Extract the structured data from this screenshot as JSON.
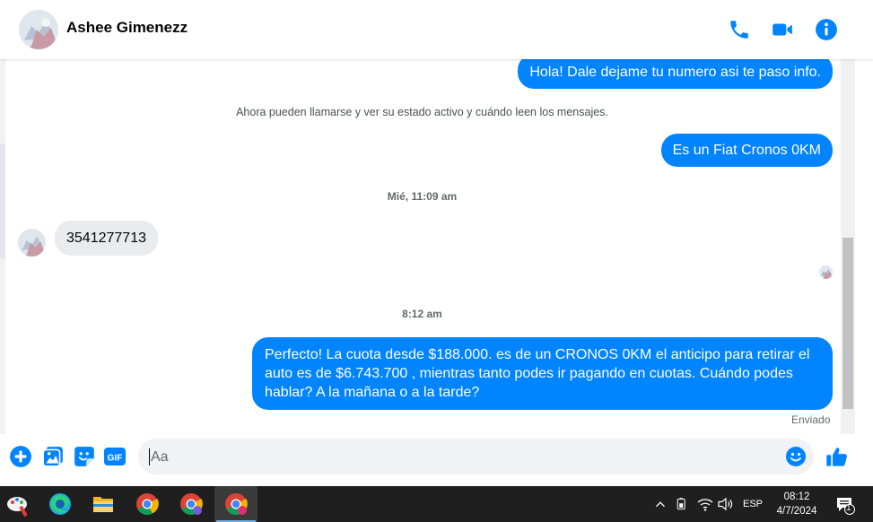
{
  "header": {
    "contact_name": "Ashee Gimenezz",
    "icons": [
      "phone-icon",
      "video-camera-icon",
      "info-icon"
    ]
  },
  "messages": {
    "msg1": "Hola! Dale dejame tu numero  asi te paso info.",
    "system_note": "Ahora pueden llamarse y ver su estado activo y cuándo leen los mensajes.",
    "msg2": "Es un Fiat Cronos 0KM",
    "timestamp1": "Mié, 11:09 am",
    "msg3": "3541277713",
    "timestamp2": "8:12 am",
    "msg4": "Perfecto! La cuota desde $188.000. es de un CRONOS 0KM el anticipo para retirar el auto es de $6.743.700 , mientras tanto podes ir pagando en cuotas. Cuándo podes hablar? A la mañana o a la tarde?",
    "status": "Enviado"
  },
  "composer": {
    "placeholder": "Aa",
    "icons": [
      "plus-icon",
      "gallery-icon",
      "sticker-icon",
      "gif-icon",
      "emoji-icon",
      "like-icon"
    ],
    "gif_label": "GIF"
  },
  "taskbar": {
    "apps": [
      "paint-app-icon",
      "edge-icon",
      "file-explorer-icon",
      "chrome-icon",
      "chrome-profile-icon",
      "chrome-profile-c-icon"
    ],
    "language": "ESP",
    "time": "08:12",
    "date": "4/7/2024",
    "notification_count": "1"
  },
  "colors": {
    "messenger_blue": "#0084ff",
    "incoming_bubble": "#e9ebee",
    "taskbar": "#1f1f1f"
  }
}
